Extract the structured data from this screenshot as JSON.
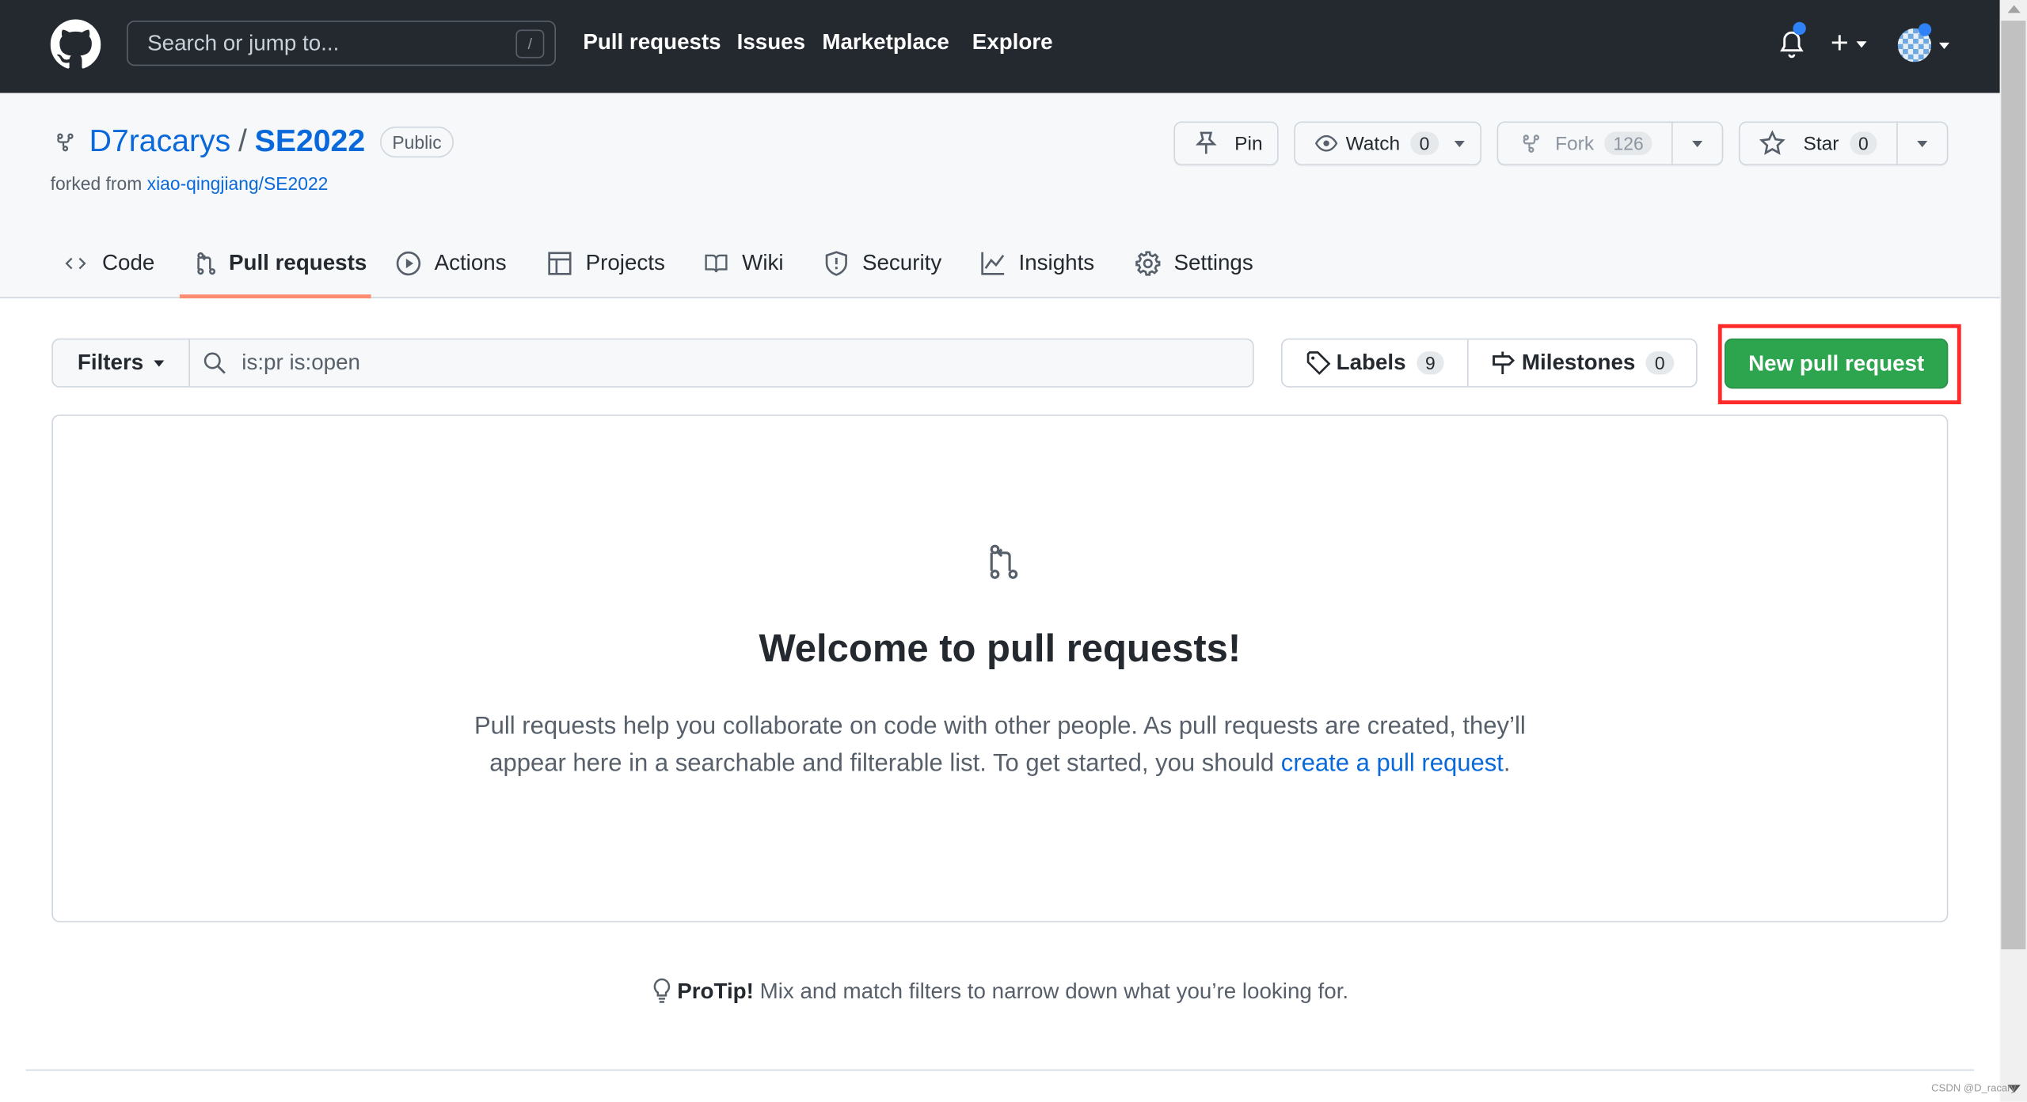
{
  "header": {
    "search_placeholder": "Search or jump to...",
    "search_shortcut": "/",
    "nav": [
      "Pull requests",
      "Issues",
      "Marketplace",
      "Explore"
    ]
  },
  "repo": {
    "owner": "D7racarys",
    "separator": "/",
    "name": "SE2022",
    "visibility": "Public",
    "forked_from_label": "forked from",
    "forked_from": "xiao-qingjiang/SE2022",
    "pin": "Pin",
    "watch": "Watch",
    "watch_count": "0",
    "fork": "Fork",
    "fork_count": "126",
    "star": "Star",
    "star_count": "0"
  },
  "tabs": [
    {
      "label": "Code",
      "icon": "code-icon"
    },
    {
      "label": "Pull requests",
      "icon": "git-pull-request-icon",
      "selected": true
    },
    {
      "label": "Actions",
      "icon": "play-icon"
    },
    {
      "label": "Projects",
      "icon": "table-icon"
    },
    {
      "label": "Wiki",
      "icon": "book-icon"
    },
    {
      "label": "Security",
      "icon": "shield-icon"
    },
    {
      "label": "Insights",
      "icon": "graph-icon"
    },
    {
      "label": "Settings",
      "icon": "gear-icon"
    }
  ],
  "toolbar": {
    "filters": "Filters",
    "search_value": "is:pr is:open",
    "labels": "Labels",
    "labels_count": "9",
    "milestones": "Milestones",
    "milestones_count": "0",
    "new_pr": "New pull request"
  },
  "blankslate": {
    "title": "Welcome to pull requests!",
    "text_1": "Pull requests help you collaborate on code with other people. As pull requests are created, they’ll",
    "text_2": "appear here in a searchable and filterable list. To get started, you should ",
    "link": "create a pull request",
    "text_end": "."
  },
  "protip": {
    "label": "ProTip!",
    "text": " Mix and match filters to narrow down what you’re looking for."
  },
  "watermark": "CSDN @D_racary",
  "colors": {
    "header": "#24292f",
    "link": "#0969da",
    "primary": "#2da44e",
    "tab_underline": "#fd8c73",
    "highlight": "#ff0000"
  }
}
